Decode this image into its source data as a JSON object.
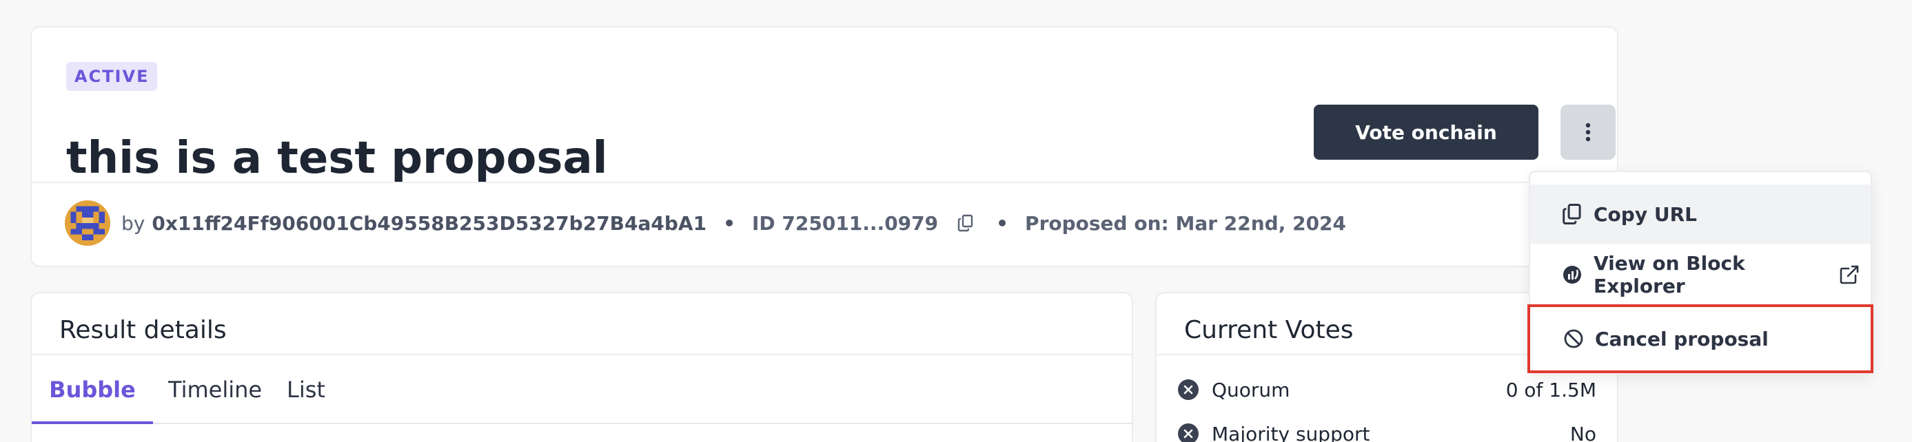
{
  "header": {
    "status": "ACTIVE",
    "title": "this is a test proposal",
    "vote_button_label": "Vote onchain",
    "more_icon": "vertical-dots-icon"
  },
  "meta": {
    "by_label": "by",
    "address": "0x11ff24Ff906001Cb49558B253D5327b27B4a4bA1",
    "separator": "•",
    "id_label": "ID 725011...0979",
    "proposed_on": "Proposed on: Mar 22nd, 2024"
  },
  "dropdown": {
    "items": [
      {
        "label": "Copy URL",
        "icon": "copy-icon"
      },
      {
        "label": "View on Block Explorer",
        "icon": "etherscan-icon",
        "trailing_icon": "external-link-icon"
      },
      {
        "label": "Cancel proposal",
        "icon": "ban-icon"
      }
    ]
  },
  "result_details": {
    "title": "Result details",
    "tabs": [
      "Bubble",
      "Timeline",
      "List"
    ],
    "active_tab": "Bubble"
  },
  "current_votes": {
    "title": "Current Votes",
    "rows": [
      {
        "label": "Quorum",
        "value": "0 of 1.5M"
      },
      {
        "label": "Majority support",
        "value": "No"
      }
    ]
  },
  "colors": {
    "accent": "#6d55d9",
    "badge_bg": "#e9e5fb",
    "primary_button": "#2d3646",
    "highlight_border": "#e03a2f"
  }
}
